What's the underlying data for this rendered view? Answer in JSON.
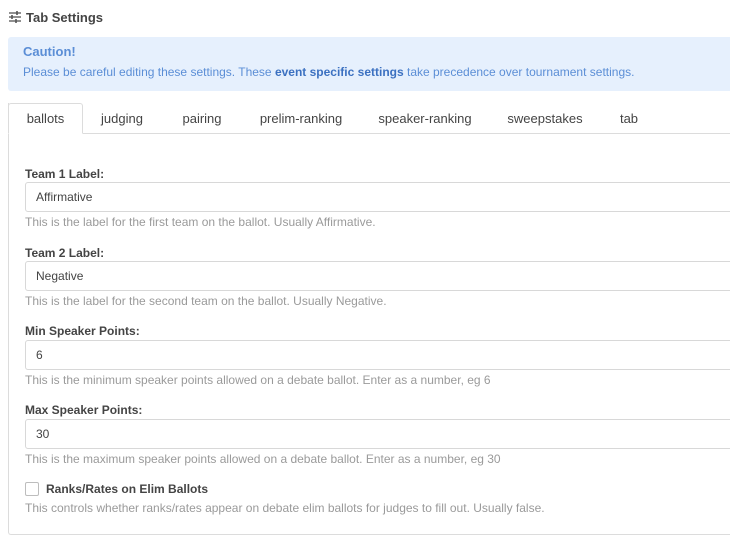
{
  "header": {
    "title": "Tab Settings",
    "icon": "sliders-icon"
  },
  "alert": {
    "title": "Caution!",
    "text_before": "Please be careful editing these settings. These ",
    "text_bold": "event specific settings",
    "text_after": " take precedence over tournament settings."
  },
  "tabs": [
    {
      "label": "ballots",
      "active": true
    },
    {
      "label": "judging"
    },
    {
      "label": "pairing"
    },
    {
      "label": "prelim-ranking"
    },
    {
      "label": "speaker-ranking"
    },
    {
      "label": "sweepstakes"
    },
    {
      "label": "tab"
    }
  ],
  "fields": [
    {
      "label": "Team 1 Label:",
      "value": "Affirmative",
      "help": "This is the label for the first team on the ballot. Usually Affirmative."
    },
    {
      "label": "Team 2 Label:",
      "value": "Negative",
      "help": "This is the label for the second team on the ballot. Usually Negative."
    },
    {
      "label": "Min Speaker Points:",
      "value": "6",
      "help": "This is the minimum speaker points allowed on a debate ballot. Enter as a number, eg 6"
    },
    {
      "label": "Max Speaker Points:",
      "value": "30",
      "help": "This is the maximum speaker points allowed on a debate ballot. Enter as a number, eg 30"
    }
  ],
  "checkbox": {
    "label": "Ranks/Rates on Elim Ballots",
    "checked": false,
    "help": "This controls whether ranks/rates appear on debate elim ballots for judges to fill out. Usually false."
  },
  "colors": {
    "alert_bg": "#e6f0fd",
    "alert_text": "#5b8ed6",
    "border": "#dcdcdc",
    "help_text": "#9a9a9a"
  }
}
